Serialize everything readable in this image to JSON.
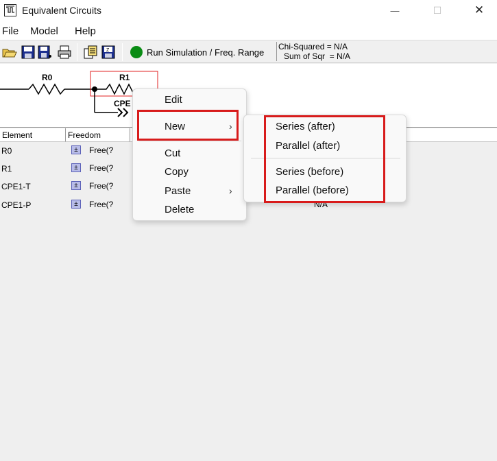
{
  "window": {
    "title": "Equivalent Circuits",
    "minimize_glyph": "—",
    "maximize_glyph": "☐",
    "close_glyph": "✕"
  },
  "menubar": {
    "items": [
      "File",
      "Model",
      "Help"
    ]
  },
  "toolbar": {
    "icons": [
      "open-folder-icon",
      "save-icon",
      "save-as-icon",
      "print-icon",
      "copy-data-icon",
      "export-icon"
    ],
    "run_label": "Run Simulation / Freq. Range",
    "run_color": "#0a8c14",
    "chi_squared": "Chi-Squared = N/A",
    "sum_of_sqr": "Sum of Sqr  = N/A"
  },
  "circuit": {
    "r0_label": "R0",
    "r1_label": "R1",
    "cpe_label": "CPE",
    "selection_color": "#e02020"
  },
  "grid": {
    "columns": [
      "Element",
      "Freedom",
      ""
    ],
    "rows": [
      {
        "element": "R0",
        "freedom": "Free(?",
        "value": ""
      },
      {
        "element": "R1",
        "freedom": "Free(?",
        "value": ""
      },
      {
        "element": "CPE1-T",
        "freedom": "Free(?",
        "value": ""
      },
      {
        "element": "CPE1-P",
        "freedom": "Free(?",
        "value": "N/A"
      }
    ],
    "pm_glyph": "±"
  },
  "context_menu": {
    "items": [
      "Edit",
      "New",
      "Cut",
      "Copy",
      "Paste",
      "Delete"
    ],
    "arrow_glyph": "›"
  },
  "submenu": {
    "items": [
      "Series (after)",
      "Parallel (after)",
      "Series (before)",
      "Parallel (before)"
    ]
  },
  "annotation_color": "#d81b1b"
}
